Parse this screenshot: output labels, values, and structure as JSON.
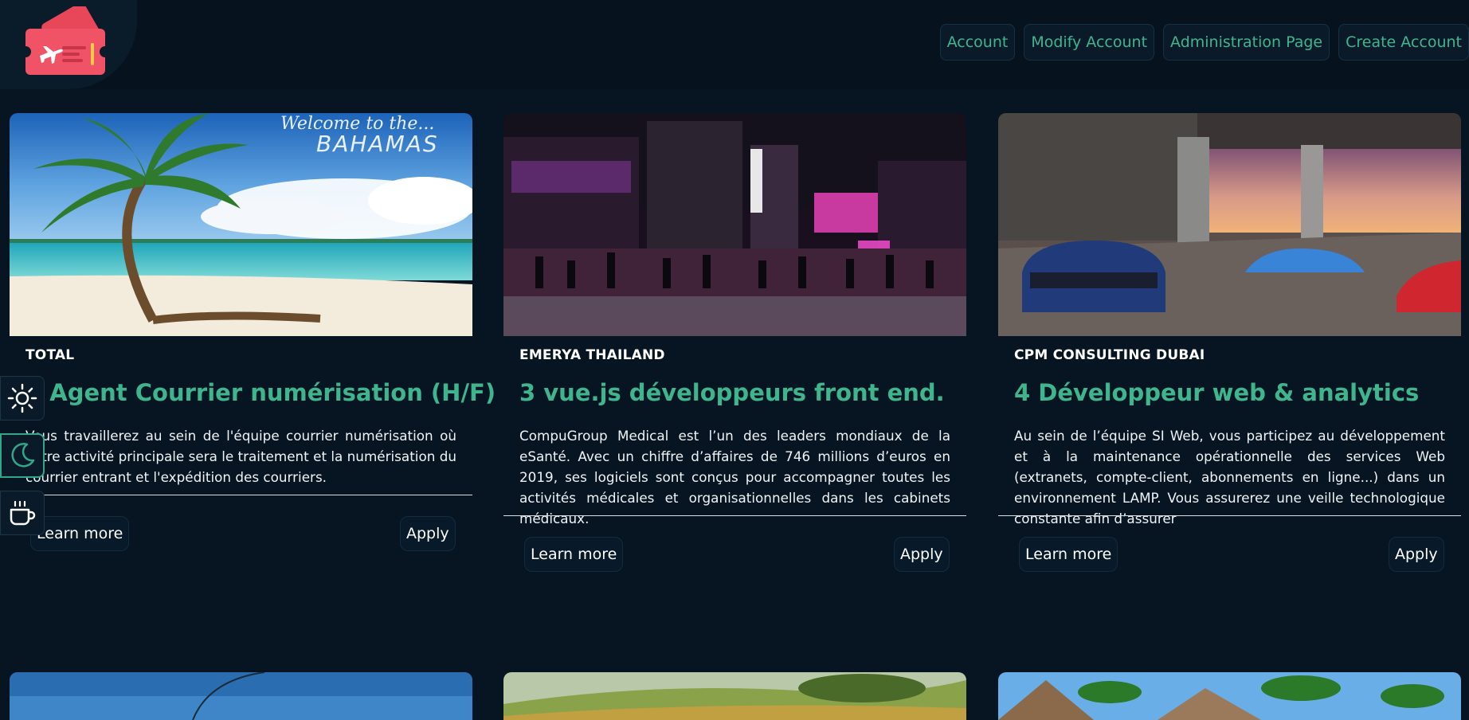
{
  "header": {
    "logo_icon": "boarding-ticket-icon",
    "nav": [
      "Account",
      "Modify Account",
      "Administration Page",
      "Create Account"
    ]
  },
  "side_tools": [
    {
      "icon": "sun-icon"
    },
    {
      "icon": "moon-icon"
    },
    {
      "icon": "coffee-cup-icon"
    }
  ],
  "cards": [
    {
      "company": "TOTAL",
      "title": "1 Agent Courrier numérisation (H/F)",
      "description": "Vous travaillerez au sein de l'équipe courrier numérisation où votre activité principale sera le traitement et la numérisation du courrier entrant et l'expédition des courriers.",
      "image_caption_line1": "Welcome to the...",
      "image_caption_line2": "BAHAMAS",
      "learn_more": "Learn more",
      "apply": "Apply"
    },
    {
      "company": "EMERYA THAILAND",
      "title": "3 vue.js développeurs front end.",
      "description": "CompuGroup Medical est l’un des leaders mondiaux de la eSanté. Avec un chiffre d’affaires de 746 millions d’euros en 2019, ses logiciels sont conçus pour accompagner toutes les activités médicales et organisationnelles dans les cabinets médicaux.",
      "learn_more": "Learn more",
      "apply": "Apply"
    },
    {
      "company": "CPM CONSULTING DUBAI",
      "title": "4 Développeur web & analytics",
      "description": "Au sein de l’équipe SI Web, vous participez au développement et à la maintenance opérationnelle des services Web (extranets, compte-client, abonnements en ligne...) dans un environnement LAMP. Vous assurerez une veille technologique constante afin d’assurer",
      "learn_more": "Learn more",
      "apply": "Apply"
    }
  ],
  "colors": {
    "background": "#071522",
    "accent": "#3fb58e",
    "logo": "#e8475a"
  }
}
